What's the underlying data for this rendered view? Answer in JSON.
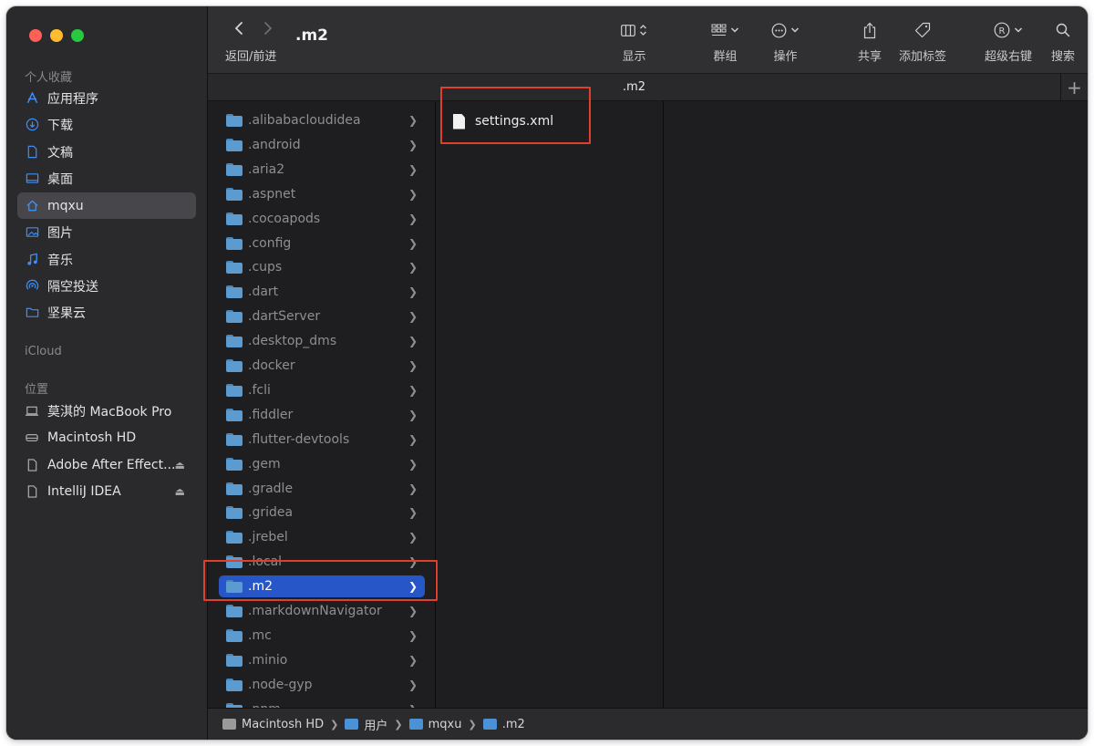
{
  "window": {
    "title": ".m2"
  },
  "sidebar": {
    "favorites_header": "个人收藏",
    "favorites": [
      {
        "label": "应用程序",
        "icon": "applications-icon"
      },
      {
        "label": "下载",
        "icon": "download-icon"
      },
      {
        "label": "文稿",
        "icon": "document-icon"
      },
      {
        "label": "桌面",
        "icon": "desktop-icon"
      },
      {
        "label": "mqxu",
        "icon": "home-icon",
        "selected": true
      },
      {
        "label": "图片",
        "icon": "photo-icon"
      },
      {
        "label": "音乐",
        "icon": "music-icon"
      },
      {
        "label": "隔空投送",
        "icon": "airdrop-icon"
      },
      {
        "label": "坚果云",
        "icon": "folder-icon"
      }
    ],
    "icloud_header": "iCloud",
    "locations_header": "位置",
    "locations": [
      {
        "label": "莫淇的 MacBook Pro",
        "icon": "laptop-icon"
      },
      {
        "label": "Macintosh HD",
        "icon": "disk-icon"
      },
      {
        "label": "Adobe After Effect...",
        "icon": "file-icon",
        "eject": true
      },
      {
        "label": "IntelliJ IDEA",
        "icon": "file-icon",
        "eject": true
      }
    ]
  },
  "toolbar": {
    "nav_label": "返回/前进",
    "view_label": "显示",
    "group_label": "群组",
    "action_label": "操作",
    "share_label": "共享",
    "tag_label": "添加标签",
    "rclick_label": "超级右键",
    "search_label": "搜索"
  },
  "tabbar": {
    "title": ".m2"
  },
  "column1": {
    "items": [
      ".alibabacloudidea",
      ".android",
      ".aria2",
      ".aspnet",
      ".cocoapods",
      ".config",
      ".cups",
      ".dart",
      ".dartServer",
      ".desktop_dms",
      ".docker",
      ".fcli",
      ".fiddler",
      ".flutter-devtools",
      ".gem",
      ".gradle",
      ".gridea",
      ".jrebel",
      ".local",
      ".m2",
      ".markdownNavigator",
      ".mc",
      ".minio",
      ".node-gyp",
      ".npm"
    ],
    "selected": ".m2"
  },
  "column2": {
    "items": [
      "settings.xml"
    ]
  },
  "pathbar": {
    "segments": [
      {
        "label": "Macintosh HD",
        "icon": "disk-icon"
      },
      {
        "label": "用户",
        "icon": "folder-icon"
      },
      {
        "label": "mqxu",
        "icon": "home-folder-icon"
      },
      {
        "label": ".m2",
        "icon": "folder-icon"
      }
    ]
  },
  "colors": {
    "selection": "#2756c9",
    "folder": "#5b9bd0",
    "highlight_box": "#e0402b",
    "accent": "#3d8ef7"
  }
}
